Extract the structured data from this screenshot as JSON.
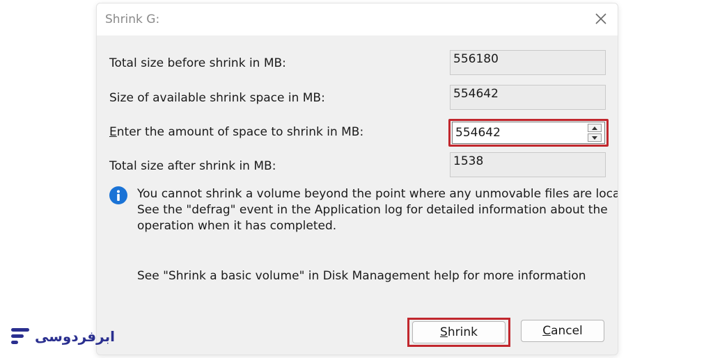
{
  "dialog": {
    "title": "Shrink G:",
    "close_icon": "close-icon"
  },
  "fields": {
    "total_before": {
      "label": "Total size before shrink in MB:",
      "value": "556180"
    },
    "available": {
      "label": "Size of available shrink space in MB:",
      "value": "554642"
    },
    "enter_amount": {
      "label_mnemonic": "E",
      "label_rest": "nter the amount of space to shrink in MB:",
      "value": "554642"
    },
    "total_after": {
      "label": "Total size after shrink in MB:",
      "value": "1538"
    }
  },
  "info": {
    "icon": "info-icon",
    "line1": "You cannot shrink a volume beyond the point where any unmovable files are located.",
    "line2": "See the \"defrag\" event in the Application log for detailed information about the",
    "line3": "operation when it has completed."
  },
  "help_text": "See \"Shrink a basic volume\" in Disk Management help for more information",
  "buttons": {
    "shrink": {
      "mnemonic": "S",
      "rest": "hrink"
    },
    "cancel": {
      "mnemonic": "C",
      "rest": "ancel"
    }
  },
  "watermark": {
    "text": "ابرفردوسی",
    "icon": "logo-lines-icon"
  },
  "colors": {
    "highlight": "#c1272d",
    "info_blue": "#1a73d6",
    "logo_blue": "#2a2f8f"
  }
}
